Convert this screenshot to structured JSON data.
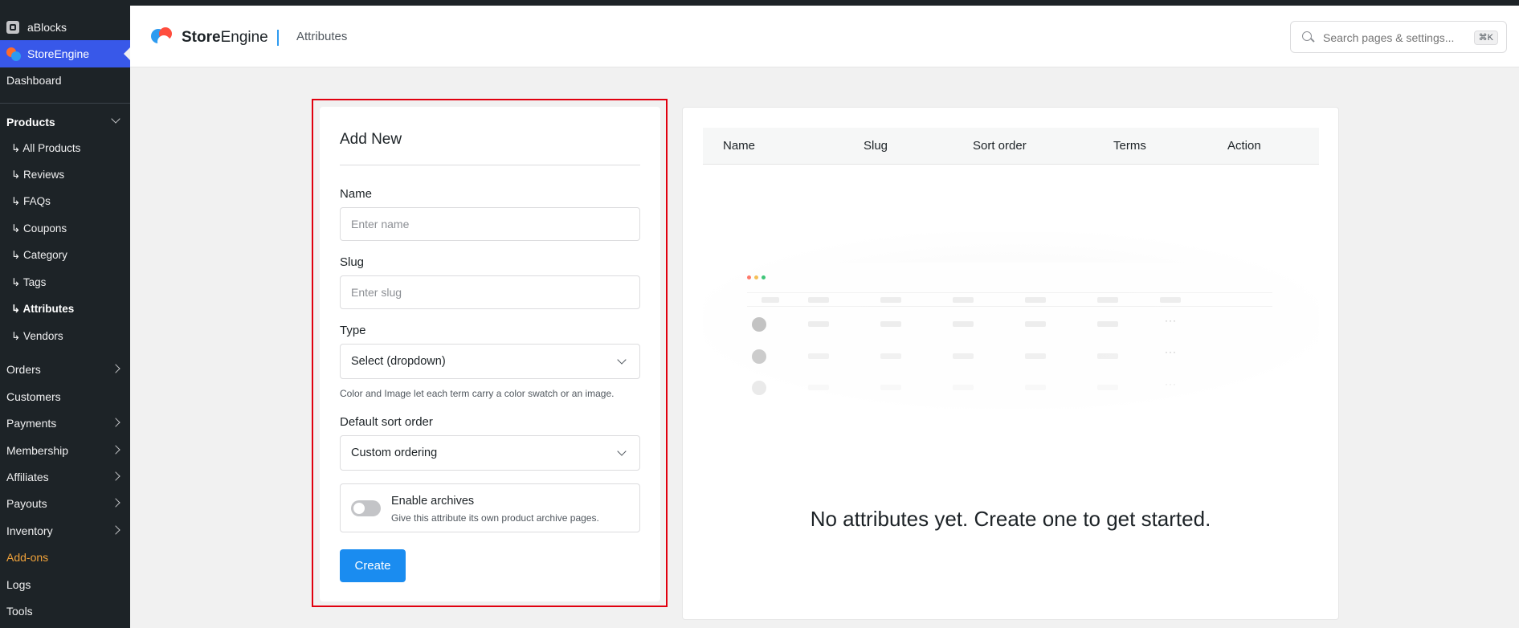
{
  "sidebar": {
    "ablocks": "aBlocks",
    "storeengine": "StoreEngine",
    "dashboard": "Dashboard",
    "products": "Products",
    "sub_items": [
      "↳ All Products",
      "↳ Reviews",
      "↳ FAQs",
      "↳ Coupons",
      "↳ Category",
      "↳ Tags",
      "↳ Attributes",
      "↳ Vendors"
    ],
    "active_sub": "↳ Attributes",
    "items": [
      "Orders",
      "Customers",
      "Payments",
      "Membership",
      "Affiliates",
      "Payouts",
      "Inventory",
      "Add-ons",
      "Logs",
      "Tools"
    ],
    "addons_color": "#f0a23a"
  },
  "header": {
    "brand_bold": "Store",
    "brand_rest": "Engine",
    "breadcrumb": "Attributes",
    "search_placeholder": "Search pages & settings...",
    "search_shortcut": "⌘K"
  },
  "form": {
    "title": "Add New",
    "name_label": "Name",
    "name_placeholder": "Enter name",
    "slug_label": "Slug",
    "slug_placeholder": "Enter slug",
    "type_label": "Type",
    "type_value": "Select (dropdown)",
    "type_help": "Color and Image let each term carry a color swatch or an image.",
    "sort_label": "Default sort order",
    "sort_value": "Custom ordering",
    "archives_title": "Enable archives",
    "archives_desc": "Give this attribute its own product archive pages.",
    "archives_enabled": false,
    "create_label": "Create"
  },
  "table": {
    "columns": [
      "Name",
      "Slug",
      "Sort order",
      "Terms",
      "Action"
    ],
    "empty_message": "No attributes yet. Create one to get started.",
    "illustration_dot_colors": [
      "#ff6b5b",
      "#f5b945",
      "#2bbf6a"
    ],
    "illustration_more": "···"
  },
  "colors": {
    "primary": "#1a8cf0",
    "sidebar_bg": "#1d2327",
    "sidebar_active": "#3858e9",
    "highlight": "#e1000f"
  }
}
